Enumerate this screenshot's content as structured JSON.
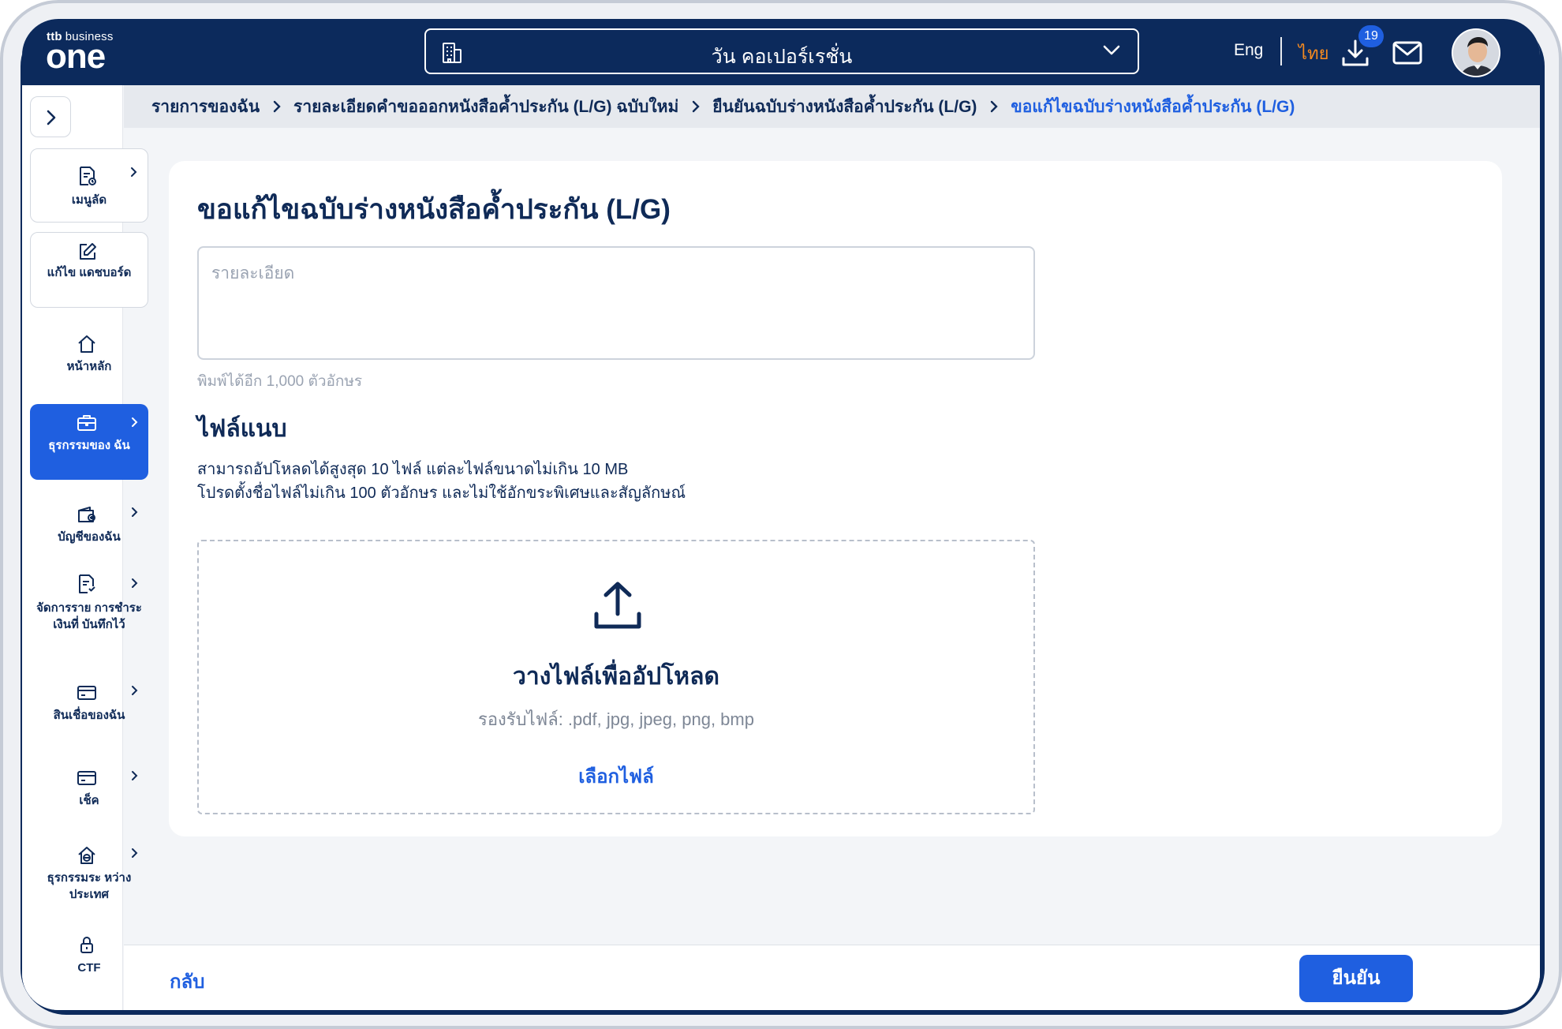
{
  "header": {
    "brand_small_bold": "ttb",
    "brand_small": "business",
    "brand_big": "one",
    "company_name": "วัน คอเปอร์เรชั่น",
    "lang_en": "Eng",
    "lang_th": "ไทย",
    "download_count": "19",
    "active_lang_color": "#f58a1f"
  },
  "sidebar": {
    "items": [
      {
        "label": "เมนูลัด",
        "icon": "shortcut-menu-icon"
      },
      {
        "label": "แก้ไข แดชบอร์ด",
        "icon": "edit-icon"
      },
      {
        "label": "หน้าหลัก",
        "icon": "home-icon"
      },
      {
        "label": "ธุรกรรมของ ฉัน",
        "icon": "briefcase-icon"
      },
      {
        "label": "บัญชีของฉัน",
        "icon": "wallet-icon"
      },
      {
        "label": "จัดการราย การชำระเงินที่ บันทึกไว้",
        "icon": "saved-payment-icon"
      },
      {
        "label": "สินเชื่อของฉัน",
        "icon": "card-icon"
      },
      {
        "label": "เช็ค",
        "icon": "cheque-icon"
      },
      {
        "label": "ธุรกรรมระ หว่างประเทศ",
        "icon": "international-icon"
      },
      {
        "label": "CTF",
        "icon": "lock-icon"
      }
    ]
  },
  "breadcrumb": [
    "รายการของฉัน",
    "รายละเอียดคำขอออกหนังสือค้ำประกัน (L/G) ฉบับใหม่",
    "ยืนยันฉบับร่างหนังสือค้ำประกัน (L/G)",
    "ขอแก้ไขฉบับร่างหนังสือค้ำประกัน (L/G)"
  ],
  "form": {
    "title": "ขอแก้ไขฉบับร่างหนังสือค้ำประกัน (L/G)",
    "detail_placeholder": "รายละเอียด",
    "detail_value": "",
    "char_remaining": "พิมพ์ได้อีก 1,000 ตัวอักษร",
    "attach_title": "ไฟล์แนบ",
    "attach_note_1": "สามารถอัปโหลดได้สูงสุด 10 ไฟล์ แต่ละไฟล์ขนาดไม่เกิน 10 MB",
    "attach_note_2": "โปรดตั้งชื่อไฟล์ไม่เกิน 100 ตัวอักษร และไม่ใช้อักขระพิเศษและสัญลักษณ์",
    "drop_title": "วางไฟล์เพื่ออัปโหลด",
    "drop_formats": "รองรับไฟล์: .pdf, jpg, jpeg, png, bmp",
    "choose_file": "เลือกไฟล์"
  },
  "footer": {
    "back": "กลับ",
    "confirm": "ยืนยัน"
  },
  "colors": {
    "navy": "#0c2a5c",
    "primary": "#1f5fe0",
    "text": "#0f2a57",
    "muted": "#9aa3b2"
  }
}
